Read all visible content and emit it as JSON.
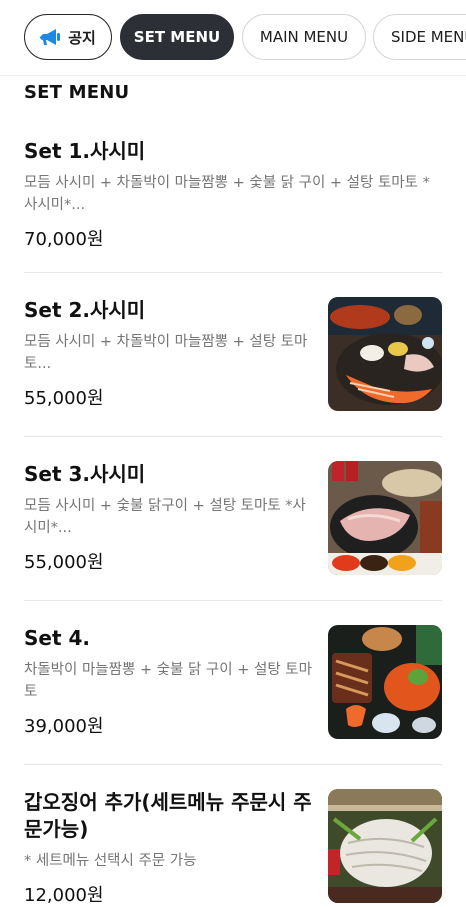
{
  "tabs": [
    {
      "label": "공지",
      "active": false
    },
    {
      "label": "SET MENU",
      "active": true
    },
    {
      "label": "MAIN MENU",
      "active": false
    },
    {
      "label": "SIDE MENU",
      "active": false
    }
  ],
  "section": {
    "title": "SET MENU"
  },
  "items": [
    {
      "name": "Set 1.사시미",
      "description": "모듬 사시미 + 차돌박이 마늘짬뽕 + 숯불 닭 구이  + 설탕 토마토 *사시미*...",
      "price": "70,000원",
      "has_image": false
    },
    {
      "name": "Set 2.사시미",
      "description": "모듬 사시미 + 차돌박이 마늘짬뽕 + 설탕 토마토...",
      "price": "55,000원",
      "has_image": true
    },
    {
      "name": "Set 3.사시미",
      "description": "모듬 사시미 + 숯불 닭구이 + 설탕 토마토 *사시미*...",
      "price": "55,000원",
      "has_image": true
    },
    {
      "name": "Set 4.",
      "description": "차돌박이 마늘짬뽕 + 숯불 닭 구이 + 설탕 토마토",
      "price": "39,000원",
      "has_image": true
    },
    {
      "name": "갑오징어 추가(세트메뉴 주문시 주문가능)",
      "description": "* 세트메뉴 선택시 주문 가능",
      "price": "12,000원",
      "has_image": true
    }
  ],
  "colors": {
    "active_tab_bg": "#2c2f36",
    "notice_icon": "#1e88e5",
    "description_text": "#767676"
  }
}
